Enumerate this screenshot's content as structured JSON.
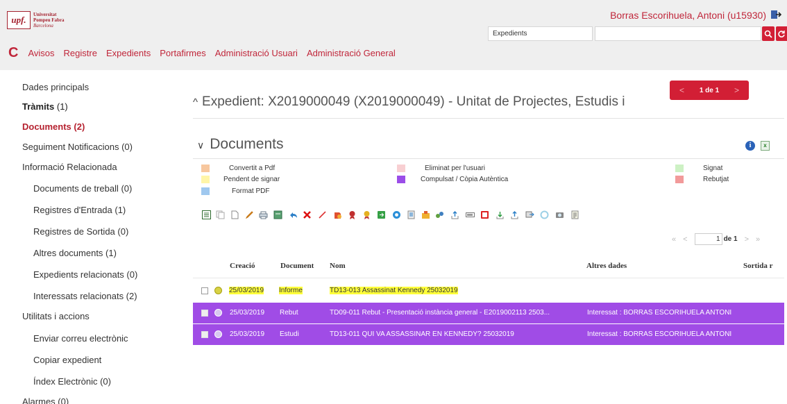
{
  "header": {
    "logo_abbr": "upf.",
    "logo_line1": "Universitat",
    "logo_line2": "Pompeu Fabra",
    "logo_line3": "Barcelona",
    "user": "Borras Escorihuela, Antoni (u15930)",
    "search_select": "Expedients",
    "search_value": "",
    "nav": [
      "Avisos",
      "Registre",
      "Expedients",
      "Portafirmes",
      "Administració Usuari",
      "Administració General"
    ]
  },
  "sidebar": {
    "dades": "Dades principals",
    "tramits": "Tràmits",
    "tramits_count": "(1)",
    "documents": "Documents (2)",
    "seguiment": "Seguiment Notificacions (0)",
    "info_rel": "Informació Relacionada",
    "docs_treball": "Documents de treball (0)",
    "reg_entrada": "Registres d'Entrada (1)",
    "reg_sortida": "Registres de Sortida (0)",
    "altres_docs": "Altres documents (1)",
    "exp_rel": "Expedients relacionats (0)",
    "int_rel": "Interessats relacionats (2)",
    "utilitats": "Utilitats i accions",
    "enviar": "Enviar correu electrònic",
    "copiar": "Copiar expedient",
    "index": "Índex Electrònic (0)",
    "alarmes": "Alarmes (0)"
  },
  "main": {
    "pager_top": "1 de 1",
    "expedient_title": "Expedient: X2019000049 (X2019000049) - Unitat de Projectes, Estudis i",
    "documents_title": "Documents",
    "legend": {
      "convertit": "Convertit a Pdf",
      "pendent": "Pendent de signar",
      "format": "Format PDF",
      "eliminat": "Eliminat per l'usuari",
      "compulsat": "Compulsat / Còpia Autèntica",
      "signat": "Signat",
      "rebutjat": "Rebutjat"
    },
    "pager2": "1 de 1",
    "columns": {
      "creacio": "Creació",
      "document": "Document",
      "nom": "Nom",
      "altres": "Altres dades",
      "sortida": "Sortida r"
    },
    "rows": [
      {
        "date": "25/03/2019",
        "doc": "Informe",
        "nom": "TD13-013 Assassinat Kennedy 25032019",
        "altres": ""
      },
      {
        "date": "25/03/2019",
        "doc": "Rebut",
        "nom": "TD09-011 Rebut - Presentació instància general - E2019002113 2503...",
        "altres": "Interessat : BORRAS ESCORIHUELA ANTONI"
      },
      {
        "date": "25/03/2019",
        "doc": "Estudi",
        "nom": "TD13-011 QUI VA ASSASSINAR EN KENNEDY? 25032019",
        "altres": "Interessat : BORRAS ESCORIHUELA ANTONI"
      }
    ]
  },
  "colors": {
    "brand": "#c0263a",
    "button": "#d21f35",
    "row_purple": "#a04ce6",
    "highlight": "#ffff3a",
    "legend_convertit": "#f7c79e",
    "legend_pendent": "#fff5a8",
    "legend_format": "#9fc8ef",
    "legend_eliminat": "#f8cfd2",
    "legend_compulsat": "#9b4de8",
    "legend_signat": "#cdf1c4",
    "legend_rebutjat": "#f29a9a"
  }
}
